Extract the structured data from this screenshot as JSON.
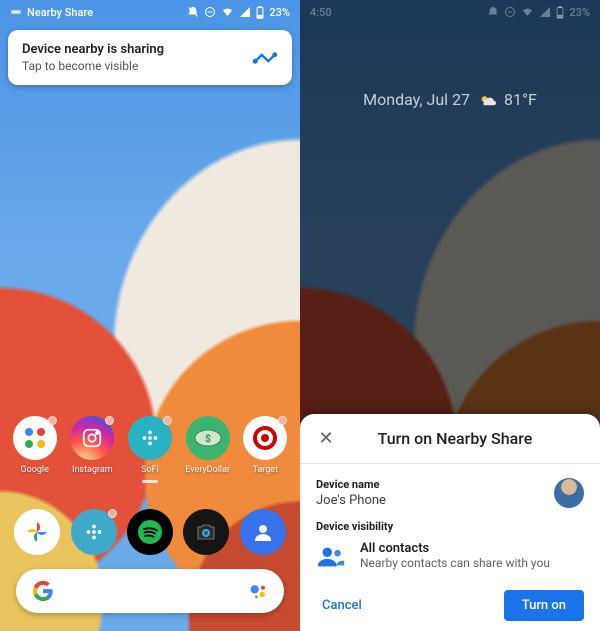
{
  "left": {
    "status": {
      "app_label": "Nearby Share",
      "battery": "23%"
    },
    "notification": {
      "title": "Device nearby is sharing",
      "subtitle": "Tap to become visible"
    },
    "apps": [
      {
        "label": "Google"
      },
      {
        "label": "Instagram"
      },
      {
        "label": "SoFi"
      },
      {
        "label": "EveryDollar"
      },
      {
        "label": "Target"
      }
    ],
    "search_placeholder": ""
  },
  "right": {
    "status": {
      "time": "4:50",
      "battery": "23%"
    },
    "widget": {
      "date": "Monday, Jul 27",
      "temp": "81°F"
    },
    "sheet": {
      "title": "Turn on Nearby Share",
      "device_name_label": "Device name",
      "device_name_value": "Joe's Phone",
      "visibility_label": "Device visibility",
      "visibility_value": "All contacts",
      "visibility_sub": "Nearby contacts can share with you",
      "cancel": "Cancel",
      "confirm": "Turn on"
    }
  },
  "colors": {
    "accent": "#1a73e8"
  }
}
